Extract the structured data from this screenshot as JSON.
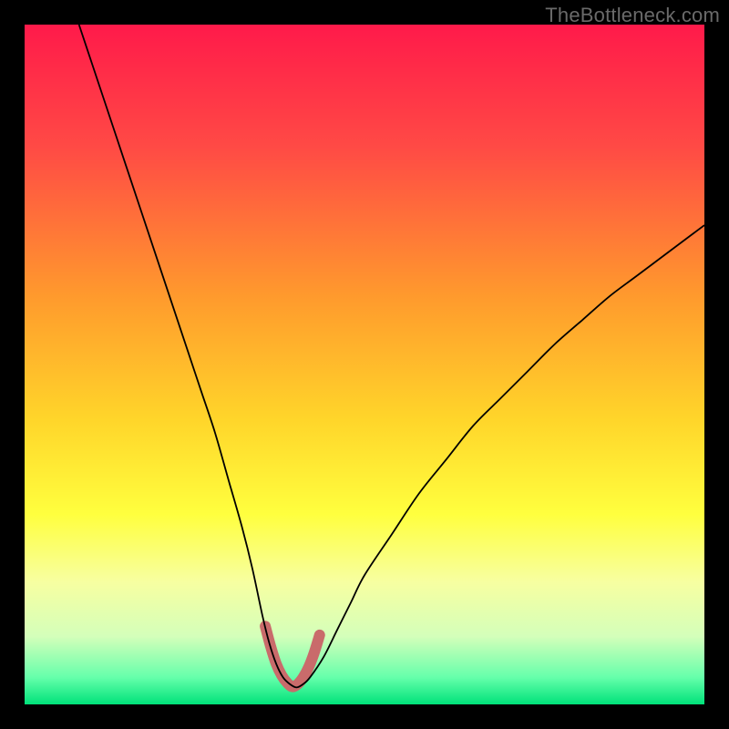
{
  "watermark": "TheBottleneck.com",
  "chart_data": {
    "type": "line",
    "title": "",
    "xlabel": "",
    "ylabel": "",
    "xlim": [
      0,
      100
    ],
    "ylim": [
      0,
      100
    ],
    "gradient_stops": [
      {
        "offset": 0,
        "color": "#ff1a4a"
      },
      {
        "offset": 18,
        "color": "#ff4a45"
      },
      {
        "offset": 40,
        "color": "#ff9a2d"
      },
      {
        "offset": 58,
        "color": "#ffd52a"
      },
      {
        "offset": 72,
        "color": "#ffff3e"
      },
      {
        "offset": 82,
        "color": "#f7ffa1"
      },
      {
        "offset": 90,
        "color": "#d4ffba"
      },
      {
        "offset": 96,
        "color": "#66ffab"
      },
      {
        "offset": 100,
        "color": "#00e27a"
      }
    ],
    "series": [
      {
        "name": "bottleneck-curve",
        "color": "#000000",
        "stroke_width": 1.8,
        "x": [
          8,
          10,
          12,
          14,
          16,
          18,
          20,
          22,
          24,
          26,
          28,
          30,
          32,
          33.5,
          35,
          36,
          37,
          38,
          39,
          40,
          41,
          42,
          44,
          46,
          48,
          50,
          54,
          58,
          62,
          66,
          70,
          74,
          78,
          82,
          86,
          90,
          94,
          98,
          100
        ],
        "y": [
          100,
          94,
          88,
          82,
          76,
          70,
          64,
          58,
          52,
          46,
          40,
          33,
          26,
          20,
          13,
          9,
          6,
          4,
          3,
          2.5,
          3,
          4,
          7,
          11,
          15,
          19,
          25,
          31,
          36,
          41,
          45,
          49,
          53,
          56.5,
          60,
          63,
          66,
          69,
          70.5
        ]
      },
      {
        "name": "highlight-segment",
        "color": "#c96b6b",
        "stroke_width": 12,
        "linecap": "round",
        "x": [
          35.4,
          36.2,
          37,
          37.8,
          38.6,
          39.4,
          40.2,
          41,
          41.8,
          42.6,
          43.4
        ],
        "y": [
          11.5,
          8.5,
          6,
          4.3,
          3.2,
          2.6,
          3,
          4,
          5.5,
          7.6,
          10.2
        ]
      }
    ]
  }
}
